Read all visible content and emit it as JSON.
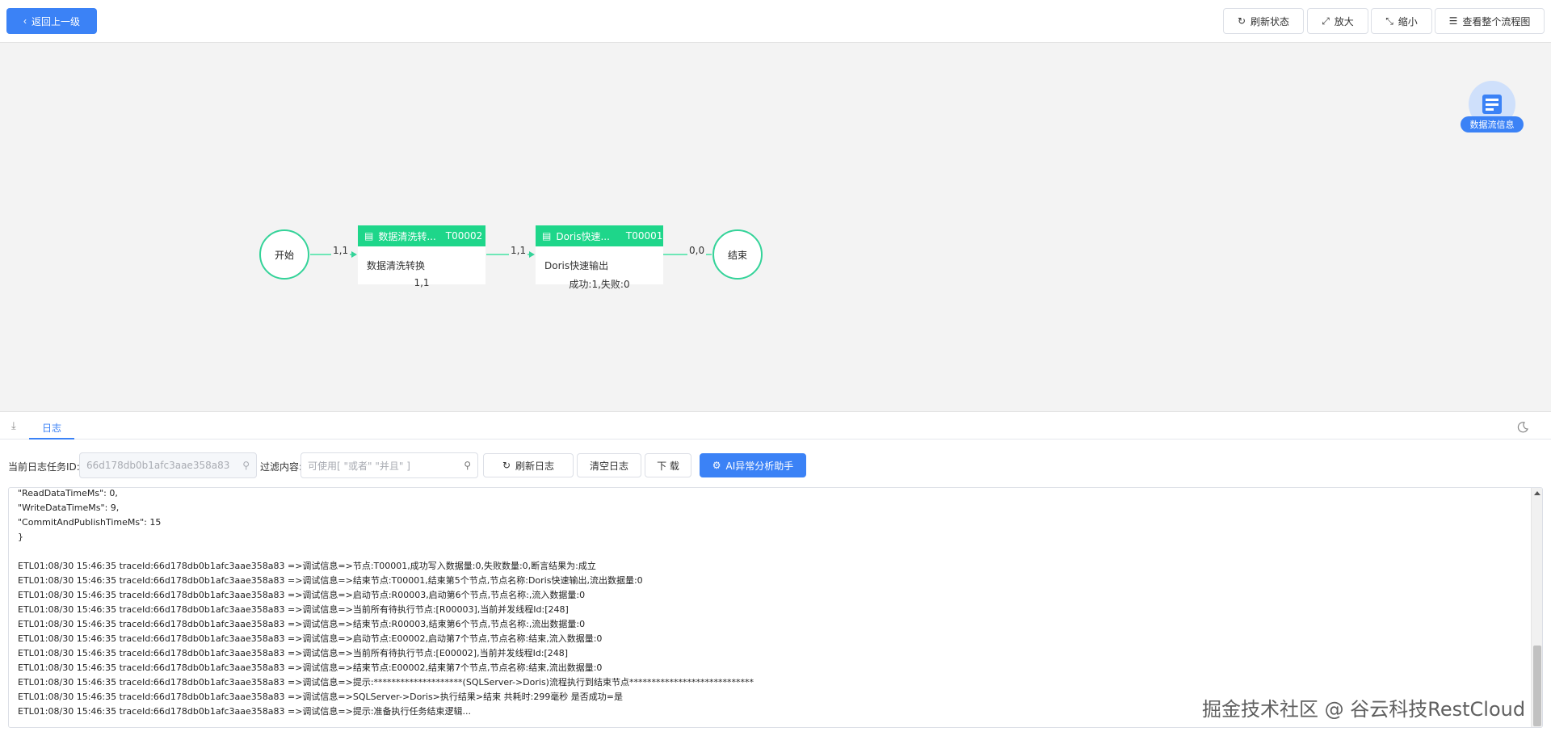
{
  "header": {
    "back_label": "返回上一级",
    "refresh_label": "刷新状态",
    "zoom_in_label": "放大",
    "zoom_out_label": "缩小",
    "view_all_label": "查看整个流程图"
  },
  "flow": {
    "start_label": "开始",
    "end_label": "结束",
    "info_badge_label": "数据流信息",
    "nodes": [
      {
        "title": "数据清洗转...",
        "code": "T00002",
        "body": "数据清洗转换",
        "stat": "1,1"
      },
      {
        "title": "Doris快速...",
        "code": "T00001",
        "body": "Doris快速输出",
        "stat": "成功:1,失败:0"
      }
    ],
    "edges": [
      "1,1",
      "1,1",
      "0,0"
    ]
  },
  "log_panel": {
    "tab_label": "日志",
    "task_id_label": "当前日志任务ID:",
    "task_id_value": "66d178db0b1afc3aae358a83",
    "filter_label": "过滤内容:",
    "filter_placeholder": "可使用[ \"或者\"   \"并且\" ]",
    "refresh_log_label": "刷新日志",
    "clear_log_label": "清空日志",
    "download_label": "下 载",
    "ai_label": "AI异常分析助手",
    "lines": [
      "\"ReadDataTimeMs\": 0,",
      "\"WriteDataTimeMs\": 9,",
      "\"CommitAndPublishTimeMs\": 15",
      "}",
      "",
      "ETL01:08/30 15:46:35 traceId:66d178db0b1afc3aae358a83 =>调试信息=>节点:T00001,成功写入数据量:0,失败数量:0,断言结果为:成立",
      "ETL01:08/30 15:46:35 traceId:66d178db0b1afc3aae358a83 =>调试信息=>结束节点:T00001,结束第5个节点,节点名称:Doris快速输出,流出数据量:0",
      "ETL01:08/30 15:46:35 traceId:66d178db0b1afc3aae358a83 =>调试信息=>启动节点:R00003,启动第6个节点,节点名称:,流入数据量:0",
      "ETL01:08/30 15:46:35 traceId:66d178db0b1afc3aae358a83 =>调试信息=>当前所有待执行节点:[R00003],当前并发线程Id:[248]",
      "ETL01:08/30 15:46:35 traceId:66d178db0b1afc3aae358a83 =>调试信息=>结束节点:R00003,结束第6个节点,节点名称:,流出数据量:0",
      "ETL01:08/30 15:46:35 traceId:66d178db0b1afc3aae358a83 =>调试信息=>启动节点:E00002,启动第7个节点,节点名称:结束,流入数据量:0",
      "ETL01:08/30 15:46:35 traceId:66d178db0b1afc3aae358a83 =>调试信息=>当前所有待执行节点:[E00002],当前并发线程Id:[248]",
      "ETL01:08/30 15:46:35 traceId:66d178db0b1afc3aae358a83 =>调试信息=>结束节点:E00002,结束第7个节点,节点名称:结束,流出数据量:0",
      "ETL01:08/30 15:46:35 traceId:66d178db0b1afc3aae358a83 =>调试信息=>提示:********************(SQLServer->Doris)流程执行到结束节点****************************",
      "ETL01:08/30 15:46:35 traceId:66d178db0b1afc3aae358a83 =>调试信息=>SQLServer->Doris>执行结果>结束 共耗时:299毫秒 是否成功=是",
      "ETL01:08/30 15:46:35 traceId:66d178db0b1afc3aae358a83 =>调试信息=>提示:准备执行任务结束逻辑..."
    ]
  },
  "watermark": "掘金技术社区 @ 谷云科技RestCloud",
  "colors": {
    "primary": "#3b82f6",
    "node_green": "#1ed68a",
    "node_border": "#34d399"
  }
}
